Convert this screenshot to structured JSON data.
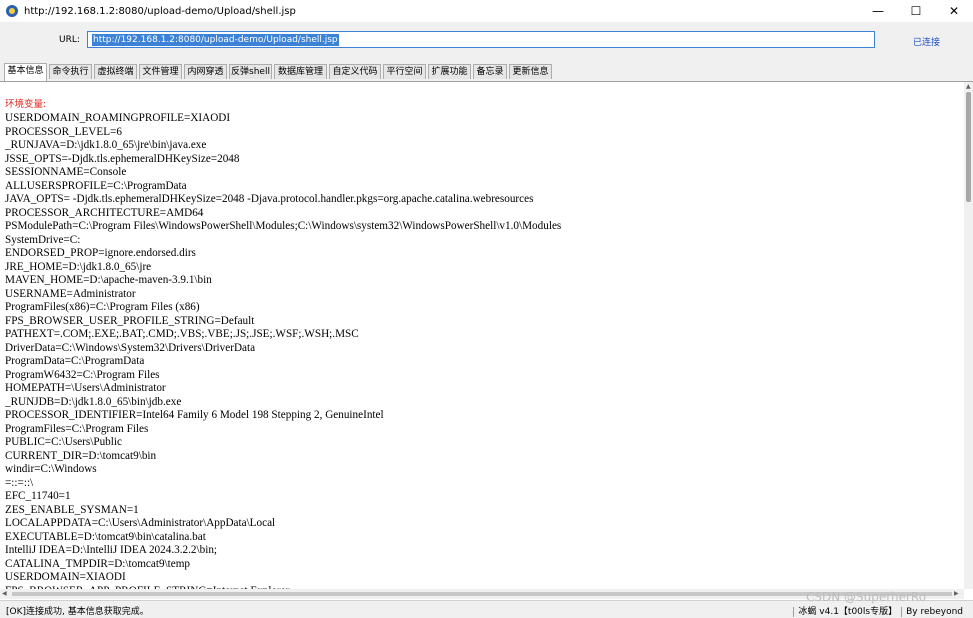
{
  "window": {
    "title": "http://192.168.1.2:8080/upload-demo/Upload/shell.jsp",
    "controls": [
      "—",
      "☐",
      "✕"
    ]
  },
  "urlbar": {
    "label": "URL:",
    "value": "http://192.168.1.2:8080/upload-demo/Upload/shell.jsp",
    "status": "已连接"
  },
  "tabs": [
    "基本信息",
    "命令执行",
    "虚拟终端",
    "文件管理",
    "内网穿透",
    "反弹shell",
    "数据库管理",
    "自定义代码",
    "平行空间",
    "扩展功能",
    "备忘录",
    "更新信息"
  ],
  "content": {
    "heading": "环境变量:",
    "lines": [
      "USERDOMAIN_ROAMINGPROFILE=XIAODI",
      "PROCESSOR_LEVEL=6",
      "_RUNJAVA=D:\\jdk1.8.0_65\\jre\\bin\\java.exe",
      "JSSE_OPTS=-Djdk.tls.ephemeralDHKeySize=2048",
      "SESSIONNAME=Console",
      "ALLUSERSPROFILE=C:\\ProgramData",
      "JAVA_OPTS= -Djdk.tls.ephemeralDHKeySize=2048 -Djava.protocol.handler.pkgs=org.apache.catalina.webresources",
      "PROCESSOR_ARCHITECTURE=AMD64",
      "PSModulePath=C:\\Program Files\\WindowsPowerShell\\Modules;C:\\Windows\\system32\\WindowsPowerShell\\v1.0\\Modules",
      "SystemDrive=C:",
      "ENDORSED_PROP=ignore.endorsed.dirs",
      "JRE_HOME=D:\\jdk1.8.0_65\\jre",
      "MAVEN_HOME=D:\\apache-maven-3.9.1\\bin",
      "USERNAME=Administrator",
      "ProgramFiles(x86)=C:\\Program Files (x86)",
      "FPS_BROWSER_USER_PROFILE_STRING=Default",
      "PATHEXT=.COM;.EXE;.BAT;.CMD;.VBS;.VBE;.JS;.JSE;.WSF;.WSH;.MSC",
      "DriverData=C:\\Windows\\System32\\Drivers\\DriverData",
      "ProgramData=C:\\ProgramData",
      "ProgramW6432=C:\\Program Files",
      "HOMEPATH=\\Users\\Administrator",
      "_RUNJDB=D:\\jdk1.8.0_65\\bin\\jdb.exe",
      "PROCESSOR_IDENTIFIER=Intel64 Family 6 Model 198 Stepping 2, GenuineIntel",
      "ProgramFiles=C:\\Program Files",
      "PUBLIC=C:\\Users\\Public",
      "CURRENT_DIR=D:\\tomcat9\\bin",
      "windir=C:\\Windows",
      "=::=::\\",
      "EFC_11740=1",
      "ZES_ENABLE_SYSMAN=1",
      "LOCALAPPDATA=C:\\Users\\Administrator\\AppData\\Local",
      "EXECUTABLE=D:\\tomcat9\\bin\\catalina.bat",
      "IntelliJ IDEA=D:\\IntelliJ IDEA 2024.3.2.2\\bin;",
      "CATALINA_TMPDIR=D:\\tomcat9\\temp",
      "USERDOMAIN=XIAODI",
      "FPS_BROWSER_APP_PROFILE_STRING=Internet Explorer"
    ]
  },
  "footer": {
    "status": "[OK]连接成功, 基本信息获取完成。",
    "version": "冰蝎 v4.1【t00ls专版】",
    "author": "By rebeyond"
  },
  "watermark": "CSDN @SuperherRo"
}
